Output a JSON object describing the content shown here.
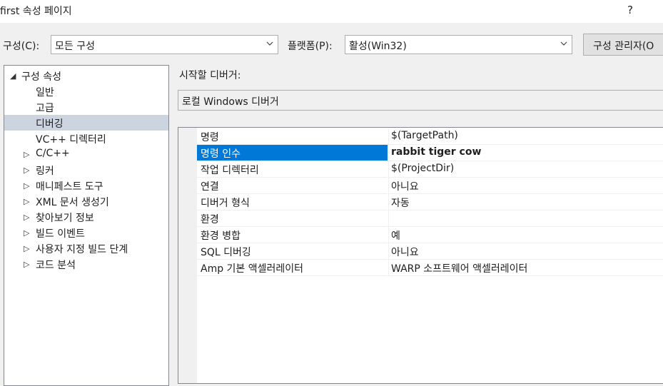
{
  "window": {
    "title": "first 속성 페이지",
    "help": "?"
  },
  "toolbar": {
    "config_label": "구성(C):",
    "config_value": "모든 구성",
    "platform_label": "플랫폼(P):",
    "platform_value": "활성(Win32)",
    "manager_button": "구성 관리자(O"
  },
  "tree": {
    "root": "구성 속성",
    "items": [
      {
        "label": "일반",
        "expandable": false
      },
      {
        "label": "고급",
        "expandable": false
      },
      {
        "label": "디버깅",
        "expandable": false,
        "selected": true
      },
      {
        "label": "VC++ 디렉터리",
        "expandable": false
      },
      {
        "label": "C/C++",
        "expandable": true
      },
      {
        "label": "링커",
        "expandable": true
      },
      {
        "label": "매니페스트 도구",
        "expandable": true
      },
      {
        "label": "XML 문서 생성기",
        "expandable": true
      },
      {
        "label": "찾아보기 정보",
        "expandable": true
      },
      {
        "label": "빌드 이벤트",
        "expandable": true
      },
      {
        "label": "사용자 지정 빌드 단계",
        "expandable": true
      },
      {
        "label": "코드 분석",
        "expandable": true
      }
    ]
  },
  "debugger": {
    "label": "시작할 디버거:",
    "value": "로컬 Windows 디버거"
  },
  "properties": [
    {
      "name": "명령",
      "value": "$(TargetPath)"
    },
    {
      "name": "명령 인수",
      "value": "rabbit tiger cow",
      "selected": true,
      "bold": true
    },
    {
      "name": "작업 디렉터리",
      "value": "$(ProjectDir)"
    },
    {
      "name": "연결",
      "value": "아니요"
    },
    {
      "name": "디버거 형식",
      "value": "자동"
    },
    {
      "name": "환경",
      "value": ""
    },
    {
      "name": "환경 병합",
      "value": "예"
    },
    {
      "name": "SQL 디버깅",
      "value": "아니요"
    },
    {
      "name": "Amp 기본 액셀러레이터",
      "value": "WARP 소프트웨어 액셀러레이터"
    }
  ],
  "colors": {
    "selection": "#0078d7",
    "tree_selection": "#ccd4e0"
  }
}
